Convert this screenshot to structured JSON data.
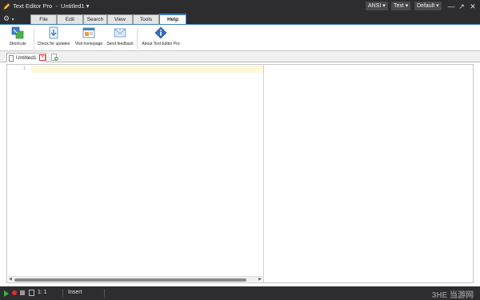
{
  "titlebar": {
    "app_name": "Text Editor Pro",
    "separator": "-",
    "document": "Untitled1",
    "encoding": "ANSI",
    "mode": "Text",
    "theme": "Default"
  },
  "window_controls": {
    "minimize": "—",
    "maximize": "↗",
    "close": "✕"
  },
  "ribbon_tabs": [
    "File",
    "Edit",
    "Search",
    "View",
    "Tools",
    "Help"
  ],
  "active_tab": "Help",
  "ribbon_buttons": [
    {
      "label": "Shortcuts",
      "icon": "shortcuts-icon"
    },
    {
      "label": "Check for updates",
      "icon": "download-icon"
    },
    {
      "label": "Visit homepage",
      "icon": "homepage-icon"
    },
    {
      "label": "Send feedback",
      "icon": "mail-icon"
    },
    {
      "label": "About Text Editor Pro",
      "icon": "info-icon"
    }
  ],
  "document_tabs": [
    {
      "name": "Untitled1"
    }
  ],
  "editor": {
    "line_numbers": [
      "1"
    ]
  },
  "status": {
    "position": "1: 1",
    "mode": "Insert"
  },
  "watermark": "3HE 当游网",
  "colors": {
    "accent": "#3c7fc0",
    "titlebar": "#2d2d30",
    "current_line": "#fdf8dc"
  }
}
